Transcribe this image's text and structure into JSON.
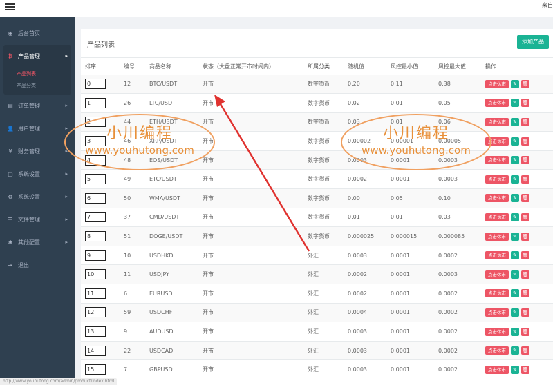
{
  "topbar": {
    "right_text": "来自"
  },
  "sidebar": {
    "items": [
      {
        "label": "后台首页",
        "icon": "dashboard-icon"
      },
      {
        "label": "产品管理",
        "icon": "bitcoin-icon",
        "expanded": true,
        "children": [
          {
            "label": "产品列表",
            "active": true
          },
          {
            "label": "产品分类"
          }
        ]
      },
      {
        "label": "订单管理",
        "icon": "order-icon"
      },
      {
        "label": "用户管理",
        "icon": "user-icon"
      },
      {
        "label": "财务管理",
        "icon": "yen-icon"
      },
      {
        "label": "系统设置",
        "icon": "file-icon"
      },
      {
        "label": "系统设置",
        "icon": "gears-icon"
      },
      {
        "label": "文件管理",
        "icon": "list-icon"
      },
      {
        "label": "其他配置",
        "icon": "gear-icon"
      },
      {
        "label": "退出",
        "icon": "logout-icon"
      }
    ]
  },
  "panel": {
    "title": "产品列表",
    "add_label": "添加产品",
    "columns": [
      "排序",
      "编号",
      "商品名称",
      "状态（大盘正常开市时间内）",
      "所属分类",
      "随机值",
      "风控最小值",
      "风控最大值",
      "操作"
    ],
    "close_label": "点击休市",
    "rows": [
      {
        "sort": "0",
        "id": "12",
        "name": "BTC/USDT",
        "status": "开市",
        "category": "数字货币",
        "rand": "0.20",
        "min": "0.11",
        "max": "0.38"
      },
      {
        "sort": "1",
        "id": "26",
        "name": "LTC/USDT",
        "status": "开市",
        "category": "数字货币",
        "rand": "0.02",
        "min": "0.01",
        "max": "0.05"
      },
      {
        "sort": "2",
        "id": "44",
        "name": "ETH/USDT",
        "status": "开市",
        "category": "数字货币",
        "rand": "0.03",
        "min": "0.01",
        "max": "0.06"
      },
      {
        "sort": "3",
        "id": "46",
        "name": "XRP/USDT",
        "status": "开市",
        "category": "数字货币",
        "rand": "0.00002",
        "min": "0.00001",
        "max": "0.00005"
      },
      {
        "sort": "4",
        "id": "48",
        "name": "EOS/USDT",
        "status": "开市",
        "category": "数字货币",
        "rand": "0.0003",
        "min": "0.0001",
        "max": "0.0003"
      },
      {
        "sort": "5",
        "id": "49",
        "name": "ETC/USDT",
        "status": "开市",
        "category": "数字货币",
        "rand": "0.0002",
        "min": "0.0001",
        "max": "0.0003"
      },
      {
        "sort": "6",
        "id": "50",
        "name": "WMA/USDT",
        "status": "开市",
        "category": "数字货币",
        "rand": "0.00",
        "min": "0.05",
        "max": "0.10"
      },
      {
        "sort": "7",
        "id": "37",
        "name": "CMD/USDT",
        "status": "开市",
        "category": "数字货币",
        "rand": "0.01",
        "min": "0.01",
        "max": "0.03"
      },
      {
        "sort": "8",
        "id": "51",
        "name": "DOGE/USDT",
        "status": "开市",
        "category": "数字货币",
        "rand": "0.000025",
        "min": "0.000015",
        "max": "0.000085"
      },
      {
        "sort": "9",
        "id": "10",
        "name": "USDHKD",
        "status": "开市",
        "category": "外汇",
        "rand": "0.0003",
        "min": "0.0001",
        "max": "0.0002"
      },
      {
        "sort": "10",
        "id": "11",
        "name": "USDJPY",
        "status": "开市",
        "category": "外汇",
        "rand": "0.0002",
        "min": "0.0001",
        "max": "0.0003"
      },
      {
        "sort": "11",
        "id": "6",
        "name": "EURUSD",
        "status": "开市",
        "category": "外汇",
        "rand": "0.0002",
        "min": "0.0001",
        "max": "0.0002"
      },
      {
        "sort": "12",
        "id": "59",
        "name": "USDCHF",
        "status": "开市",
        "category": "外汇",
        "rand": "0.0004",
        "min": "0.0001",
        "max": "0.0002"
      },
      {
        "sort": "13",
        "id": "9",
        "name": "AUDUSD",
        "status": "开市",
        "category": "外汇",
        "rand": "0.0003",
        "min": "0.0001",
        "max": "0.0002"
      },
      {
        "sort": "14",
        "id": "22",
        "name": "USDCAD",
        "status": "开市",
        "category": "外汇",
        "rand": "0.0003",
        "min": "0.0001",
        "max": "0.0002"
      },
      {
        "sort": "15",
        "id": "7",
        "name": "GBPUSD",
        "status": "开市",
        "category": "外汇",
        "rand": "0.0003",
        "min": "0.0001",
        "max": "0.0002"
      }
    ]
  },
  "watermark": {
    "title": "小川编程",
    "url": "www.youhutong.com"
  },
  "status_bar": {
    "url": "http://www.youhutong.com/admin/product/index.html"
  },
  "colors": {
    "sidebar": "#2f4050",
    "accent": "#1ab394",
    "danger": "#ed5565"
  }
}
